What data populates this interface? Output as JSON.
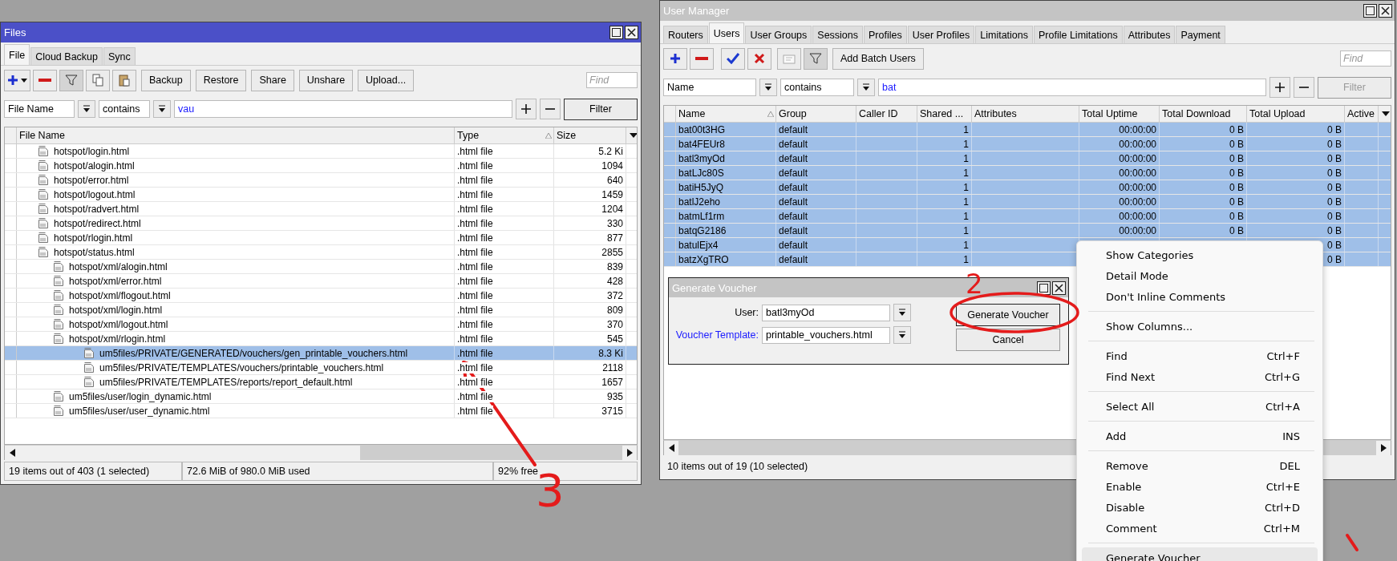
{
  "files_window": {
    "title": "Files",
    "active": true,
    "tabs": [
      {
        "label": "File",
        "selected": true
      },
      {
        "label": "Cloud Backup",
        "selected": false
      },
      {
        "label": "Sync",
        "selected": false
      }
    ],
    "toolbar": {
      "buttons": [
        "Backup",
        "Restore",
        "Share",
        "Unshare",
        "Upload..."
      ],
      "find_placeholder": "Find"
    },
    "filter": {
      "field": "File Name",
      "operator": "contains",
      "value": "vau",
      "button": "Filter",
      "disabled": false
    },
    "columns": [
      {
        "label": "File Name",
        "sorted": false
      },
      {
        "label": "Type",
        "sorted": true
      },
      {
        "label": "Size",
        "sorted": false
      }
    ],
    "rows": [
      {
        "name": "hotspot/login.html",
        "type": ".html file",
        "size": "5.2 Ki",
        "selected": false
      },
      {
        "name": "hotspot/alogin.html",
        "type": ".html file",
        "size": "1094",
        "selected": false
      },
      {
        "name": "hotspot/error.html",
        "type": ".html file",
        "size": "640",
        "selected": false
      },
      {
        "name": "hotspot/logout.html",
        "type": ".html file",
        "size": "1459",
        "selected": false
      },
      {
        "name": "hotspot/radvert.html",
        "type": ".html file",
        "size": "1204",
        "selected": false
      },
      {
        "name": "hotspot/redirect.html",
        "type": ".html file",
        "size": "330",
        "selected": false
      },
      {
        "name": "hotspot/rlogin.html",
        "type": ".html file",
        "size": "877",
        "selected": false
      },
      {
        "name": "hotspot/status.html",
        "type": ".html file",
        "size": "2855",
        "selected": false,
        "children": [
          {
            "name": "hotspot/xml/alogin.html",
            "type": ".html file",
            "size": "839",
            "selected": false
          },
          {
            "name": "hotspot/xml/error.html",
            "type": ".html file",
            "size": "428",
            "selected": false
          },
          {
            "name": "hotspot/xml/flogout.html",
            "type": ".html file",
            "size": "372",
            "selected": false
          },
          {
            "name": "hotspot/xml/login.html",
            "type": ".html file",
            "size": "809",
            "selected": false
          },
          {
            "name": "hotspot/xml/logout.html",
            "type": ".html file",
            "size": "370",
            "selected": false
          },
          {
            "name": "hotspot/xml/rlogin.html",
            "type": ".html file",
            "size": "545",
            "selected": false,
            "children": [
              {
                "name": "um5files/PRIVATE/GENERATED/vouchers/gen_printable_vouchers.html",
                "type": ".html file",
                "size": "8.3 Ki",
                "selected": true
              },
              {
                "name": "um5files/PRIVATE/TEMPLATES/vouchers/printable_vouchers.html",
                "type": ".html file",
                "size": "2118",
                "selected": false
              },
              {
                "name": "um5files/PRIVATE/TEMPLATES/reports/report_default.html",
                "type": ".html file",
                "size": "1657",
                "selected": false
              }
            ]
          },
          {
            "name": "um5files/user/login_dynamic.html",
            "type": ".html file",
            "size": "935",
            "selected": false
          },
          {
            "name": "um5files/user/user_dynamic.html",
            "type": ".html file",
            "size": "3715",
            "selected": false
          }
        ]
      }
    ],
    "status": [
      "19 items out of 403 (1 selected)",
      "72.6 MiB of 980.0 MiB used",
      "92% free"
    ]
  },
  "user_manager_window": {
    "title": "User Manager",
    "active": false,
    "tabs": [
      {
        "label": "Routers",
        "selected": false
      },
      {
        "label": "Users",
        "selected": true
      },
      {
        "label": "User Groups",
        "selected": false
      },
      {
        "label": "Sessions",
        "selected": false
      },
      {
        "label": "Profiles",
        "selected": false
      },
      {
        "label": "User Profiles",
        "selected": false
      },
      {
        "label": "Limitations",
        "selected": false
      },
      {
        "label": "Profile Limitations",
        "selected": false
      },
      {
        "label": "Attributes",
        "selected": false
      },
      {
        "label": "Payment",
        "selected": false
      }
    ],
    "toolbar": {
      "buttons": [
        "Add Batch Users"
      ],
      "find_placeholder": "Find"
    },
    "filter": {
      "field": "Name",
      "operator": "contains",
      "value": "bat",
      "button": "Filter",
      "disabled": true
    },
    "columns": [
      {
        "label": "Name",
        "sorted": true
      },
      {
        "label": "Group",
        "sorted": false
      },
      {
        "label": "Caller ID",
        "sorted": false
      },
      {
        "label": "Shared ...",
        "sorted": false
      },
      {
        "label": "Attributes",
        "sorted": false
      },
      {
        "label": "Total Uptime",
        "sorted": false
      },
      {
        "label": "Total Download",
        "sorted": false
      },
      {
        "label": "Total Upload",
        "sorted": false
      },
      {
        "label": "Active",
        "sorted": false
      }
    ],
    "rows": [
      {
        "name": "bat00t3HG",
        "group": "default",
        "shared_users": "1",
        "total_uptime": "00:00:00",
        "total_download": "0 B",
        "total_upload": "0 B",
        "selected": true
      },
      {
        "name": "bat4FEUr8",
        "group": "default",
        "shared_users": "1",
        "total_uptime": "00:00:00",
        "total_download": "0 B",
        "total_upload": "0 B",
        "selected": true
      },
      {
        "name": "batl3myOd",
        "group": "default",
        "shared_users": "1",
        "total_uptime": "00:00:00",
        "total_download": "0 B",
        "total_upload": "0 B",
        "selected": true
      },
      {
        "name": "batLJc80S",
        "group": "default",
        "shared_users": "1",
        "total_uptime": "00:00:00",
        "total_download": "0 B",
        "total_upload": "0 B",
        "selected": true
      },
      {
        "name": "batiH5JyQ",
        "group": "default",
        "shared_users": "1",
        "total_uptime": "00:00:00",
        "total_download": "0 B",
        "total_upload": "0 B",
        "selected": true
      },
      {
        "name": "batlJ2eho",
        "group": "default",
        "shared_users": "1",
        "total_uptime": "00:00:00",
        "total_download": "0 B",
        "total_upload": "0 B",
        "selected": true
      },
      {
        "name": "batmLf1rm",
        "group": "default",
        "shared_users": "1",
        "total_uptime": "00:00:00",
        "total_download": "0 B",
        "total_upload": "0 B",
        "selected": true
      },
      {
        "name": "batqG2186",
        "group": "default",
        "shared_users": "1",
        "total_uptime": "00:00:00",
        "total_download": "0 B",
        "total_upload": "0 B",
        "selected": true
      },
      {
        "name": "batulEjx4",
        "group": "default",
        "shared_users": "1",
        "total_upload": "0 B",
        "selected": true
      },
      {
        "name": "batzXgTRO",
        "group": "default",
        "shared_users": "1",
        "total_upload": "0 B",
        "selected": true
      }
    ],
    "status": [
      "10 items out of 19 (10 selected)"
    ]
  },
  "voucher_dialog": {
    "title": "Generate Voucher",
    "fields": [
      {
        "label": "User:",
        "value": "batl3myOd",
        "link": false
      },
      {
        "label": "Voucher Template:",
        "value": "printable_vouchers.html",
        "link": true
      }
    ],
    "buttons": [
      "Generate Voucher",
      "Cancel"
    ]
  },
  "context_menu": {
    "items": [
      {
        "kind": "item",
        "label": "Show Categories",
        "highlighted": false
      },
      {
        "kind": "item",
        "label": "Detail Mode",
        "highlighted": false
      },
      {
        "kind": "item",
        "label": "Don't Inline Comments",
        "highlighted": false
      },
      {
        "kind": "separator"
      },
      {
        "kind": "item",
        "label": "Show Columns...",
        "highlighted": false
      },
      {
        "kind": "separator"
      },
      {
        "kind": "item",
        "label": "Find",
        "shortcut": "Ctrl+F",
        "highlighted": false
      },
      {
        "kind": "item",
        "label": "Find Next",
        "shortcut": "Ctrl+G",
        "highlighted": false
      },
      {
        "kind": "separator"
      },
      {
        "kind": "item",
        "label": "Select All",
        "shortcut": "Ctrl+A",
        "highlighted": false
      },
      {
        "kind": "separator"
      },
      {
        "kind": "item",
        "label": "Add",
        "shortcut": "INS",
        "highlighted": false
      },
      {
        "kind": "separator"
      },
      {
        "kind": "item",
        "label": "Remove",
        "shortcut": "DEL",
        "highlighted": false
      },
      {
        "kind": "item",
        "label": "Enable",
        "shortcut": "Ctrl+E",
        "highlighted": false
      },
      {
        "kind": "item",
        "label": "Disable",
        "shortcut": "Ctrl+D",
        "highlighted": false
      },
      {
        "kind": "item",
        "label": "Comment",
        "shortcut": "Ctrl+M",
        "highlighted": false
      },
      {
        "kind": "separator"
      },
      {
        "kind": "item",
        "label": "Generate Voucher",
        "highlighted": true
      }
    ]
  },
  "annotations": [
    {
      "kind": "arrow"
    },
    {
      "kind": "label",
      "text": "3"
    },
    {
      "kind": "ellipse"
    },
    {
      "kind": "label",
      "text": "2"
    },
    {
      "kind": "stroke"
    }
  ]
}
